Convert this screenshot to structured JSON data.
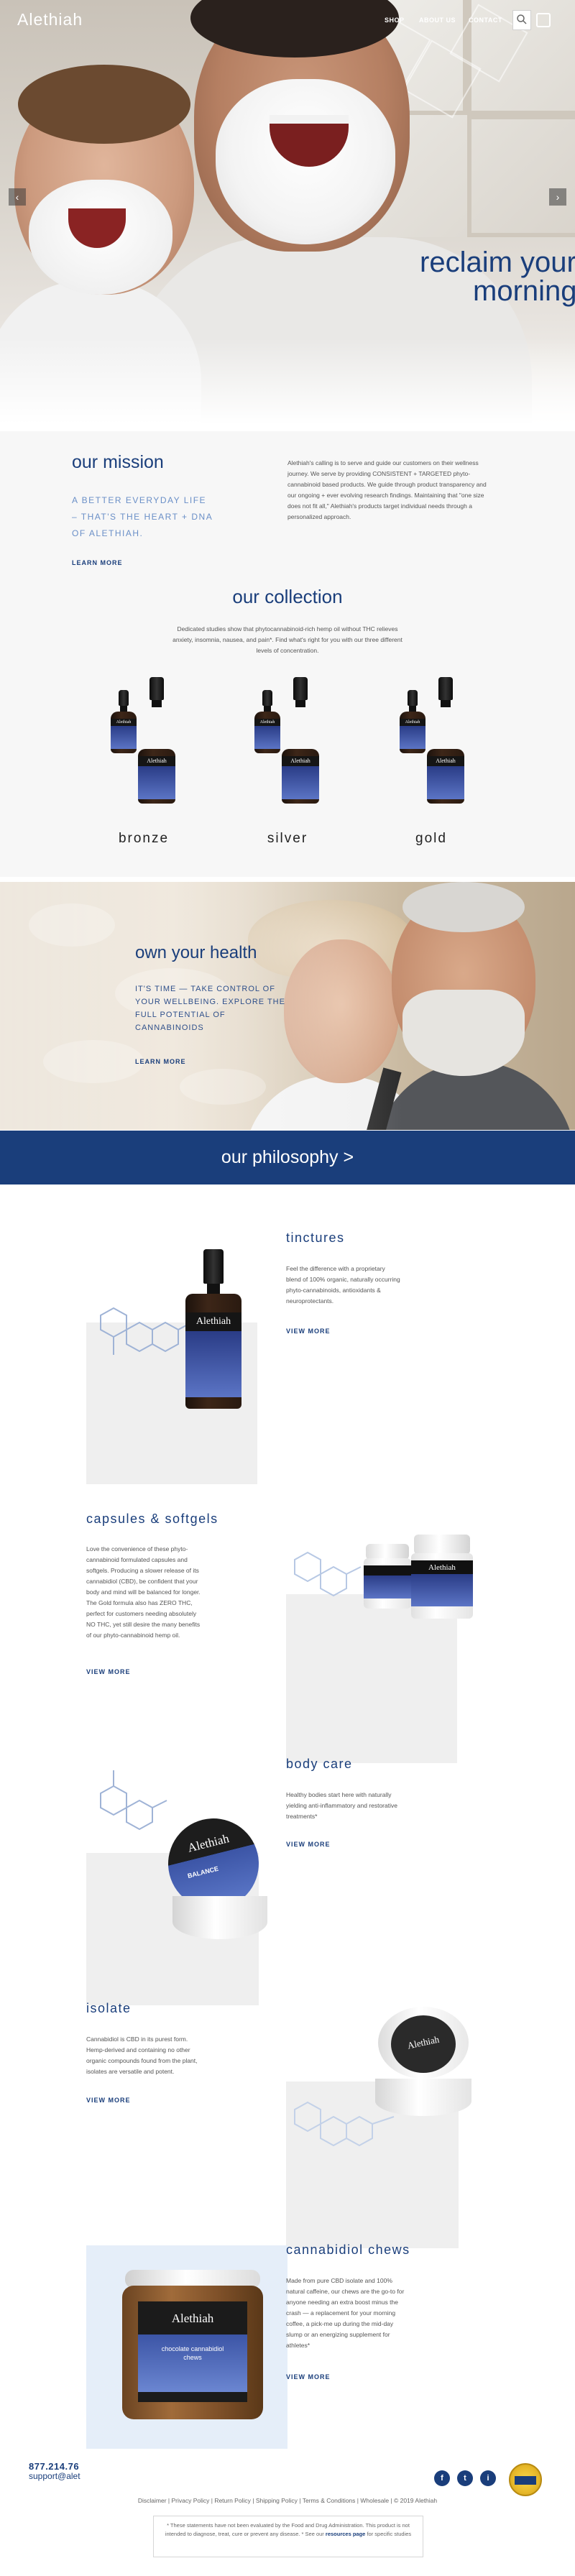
{
  "brand": {
    "logo": "Alethiah",
    "primary": "#1a3e7b",
    "accent": "#6a8fc7"
  },
  "nav": {
    "links": [
      "SHOP",
      "ABOUT US",
      "CONTACT"
    ],
    "search_icon": "search-icon",
    "cart_icon": "cart-icon"
  },
  "hero": {
    "tagline_line1": "reclaim your",
    "tagline_line2": "morning",
    "prev_arrow": "‹",
    "next_arrow": "›"
  },
  "mission": {
    "title": "our mission",
    "subtitle": "A BETTER EVERYDAY LIFE – THAT'S THE HEART + DNA OF ALETHIAH.",
    "learn_more": "LEARN MORE",
    "body": "Alethiah's calling is to serve and guide our customers on their wellness journey. We serve by providing CONSISTENT + TARGETED phyto-cannabinoid based products. We guide through product transparency and our ongoing + ever evolving research findings. Maintaining that \"one size does not fit all,\" Alethiah's products target individual needs through a personalized approach."
  },
  "collection": {
    "title": "our collection",
    "body": "Dedicated studies show that phytocannabinoid-rich hemp oil without THC relieves anxiety, insomnia, nausea, and pain*. Find what's right for you with our three different levels of concentration.",
    "tiers": [
      "bronze",
      "silver",
      "gold"
    ],
    "bottle_label": "Alethiah"
  },
  "health": {
    "title": "own your health",
    "body": "IT'S TIME — TAKE CONTROL OF YOUR WELLBEING. EXPLORE THE FULL POTENTIAL OF CANNABINOIDS",
    "learn_more": "LEARN MORE"
  },
  "philosophy": {
    "label": "our philosophy >"
  },
  "products": {
    "tinctures": {
      "title": "tinctures",
      "body": "Feel the difference with a proprietary blend of 100% organic, naturally occurring phyto-cannabinoids, antioxidants & neuroprotectants.",
      "cta": "VIEW MORE"
    },
    "capsules": {
      "title": "capsules & softgels",
      "body": "Love the convenience of these phyto-cannabinoid formulated capsules and softgels. Producing a slower release of its cannabidiol (CBD), be confident that your body and mind will be balanced for longer. The Gold formula also has ZERO THC, perfect for customers needing absolutely NO THC, yet still desire the many benefits of our phyto-cannabinoid hemp oil.",
      "cta": "VIEW MORE",
      "label": "Alethiah"
    },
    "body_care": {
      "title": "body care",
      "body": "Healthy bodies start here with naturally yielding anti-inflammatory and restorative treatments*",
      "cta": "VIEW MORE",
      "jar_label": "Alethiah",
      "jar_sub": "BALANCE"
    },
    "isolate": {
      "title": "isolate",
      "body": "Cannabidiol is CBD in its purest form. Hemp-derived and containing no other organic compounds found from the plant, isolates are versatile and potent.",
      "cta": "VIEW MORE",
      "jar_label": "Alethiah"
    },
    "chews": {
      "title": "cannabidiol chews",
      "body": "Made from pure CBD isolate and 100% natural caffeine, our chews are the go-to for anyone needing an extra boost minus the crash — a replacement for your morning coffee, a pick-me up during the mid-day slump or an energizing supplement for athletes*",
      "cta": "VIEW MORE",
      "jar_label": "Alethiah",
      "jar_sub": "chocolate cannabidiol chews"
    }
  },
  "footer": {
    "phone": "877.214.76",
    "email": "support@alet",
    "social": [
      "f",
      "t",
      "i"
    ],
    "social_icons": [
      "facebook-icon",
      "twitter-icon",
      "instagram-icon"
    ],
    "links": [
      "Disclaimer",
      "Privacy Policy",
      "Return Policy",
      "Shipping Policy",
      "Terms & Conditions",
      "Wholesale",
      "© 2019 Alethiah"
    ],
    "disclaimer_text": "* These statements have not been evaluated by the Food and Drug Administration. This product is not intended to diagnose, treat, cure or prevent any disease. * See our",
    "disclaimer_link": "resources page",
    "disclaimer_tail": "for specific studies"
  }
}
